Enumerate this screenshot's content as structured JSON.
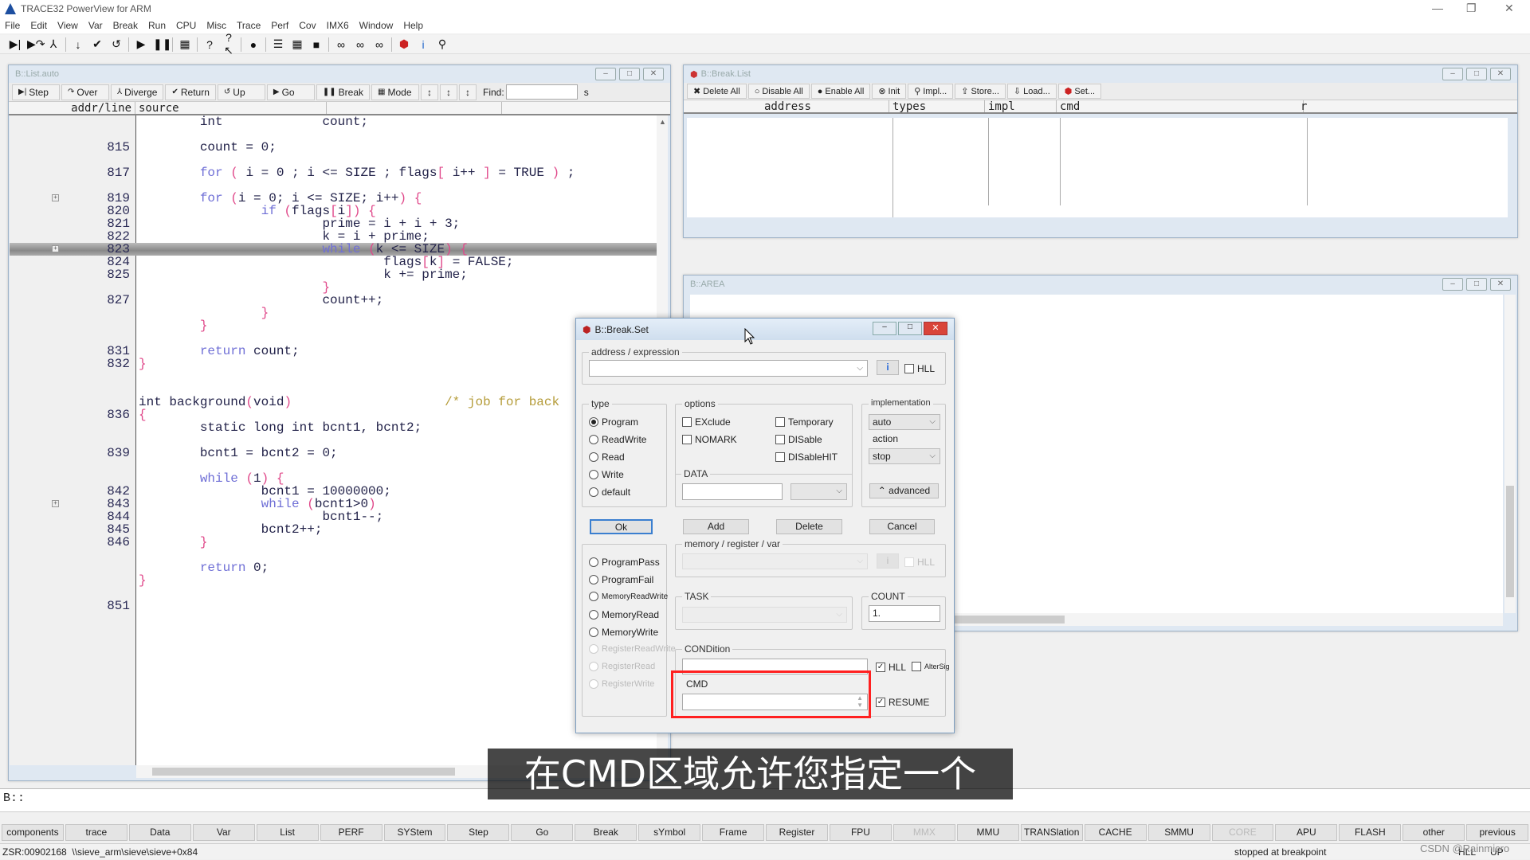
{
  "app": {
    "title": "TRACE32 PowerView for ARM"
  },
  "menu": [
    "File",
    "Edit",
    "View",
    "Var",
    "Break",
    "Run",
    "CPU",
    "Misc",
    "Trace",
    "Perf",
    "Cov",
    "IMX6",
    "Window",
    "Help"
  ],
  "toolbar_icons": [
    "step-icon",
    "over-icon",
    "diverge-icon",
    "down-icon",
    "return-icon",
    "up-icon",
    "go-icon",
    "break-icon",
    "mode-icon",
    "help-icon",
    "context-help-icon",
    "stop-icon",
    "list-icon",
    "mix-icon",
    "memory-icon",
    "view1-icon",
    "view2-icon",
    "view3-icon",
    "breakpoint-icon",
    "info-icon",
    "wrench-icon"
  ],
  "list_window": {
    "title": "B::List.auto",
    "buttons": [
      "Step",
      "Over",
      "Diverge",
      "Return",
      "Up",
      "Go",
      "Break",
      "Mode"
    ],
    "button_icons": [
      "▶|",
      "↷",
      "⅄",
      "✔",
      "↺",
      "▶",
      "❚❚",
      "▦"
    ],
    "find_label": "Find:",
    "find_value": "",
    "trailing": "s",
    "headers": [
      "addr/line",
      "source"
    ],
    "rows": [
      {
        "n": "",
        "t": [
          [
            "n",
            "        int             count;"
          ]
        ]
      },
      {
        "n": "",
        "t": []
      },
      {
        "n": "815",
        "t": [
          [
            "n",
            "        count = 0;"
          ]
        ]
      },
      {
        "n": "",
        "t": []
      },
      {
        "n": "817",
        "t": [
          [
            "n",
            "        "
          ],
          [
            "k",
            "for"
          ],
          [
            "n",
            " "
          ],
          [
            "p",
            "("
          ],
          [
            "n",
            " i = 0 ; i <= SIZE ; flags"
          ],
          [
            "p",
            "["
          ],
          [
            "n",
            " i++ "
          ],
          [
            "p",
            "]"
          ],
          [
            "n",
            " = TRUE "
          ],
          [
            "p",
            ")"
          ],
          [
            "n",
            " ;"
          ]
        ]
      },
      {
        "n": "",
        "t": []
      },
      {
        "n": "819",
        "m": true,
        "t": [
          [
            "n",
            "        "
          ],
          [
            "k",
            "for"
          ],
          [
            "n",
            " "
          ],
          [
            "p",
            "("
          ],
          [
            "n",
            "i = 0; i <= SIZE; i++"
          ],
          [
            "p",
            ")"
          ],
          [
            "n",
            " "
          ],
          [
            "p",
            "{"
          ]
        ]
      },
      {
        "n": "820",
        "t": [
          [
            "n",
            "                "
          ],
          [
            "k",
            "if"
          ],
          [
            "n",
            " "
          ],
          [
            "p",
            "("
          ],
          [
            "n",
            "flags"
          ],
          [
            "p",
            "["
          ],
          [
            "n",
            "i"
          ],
          [
            "p",
            "])"
          ],
          [
            "n",
            " "
          ],
          [
            "p",
            "{"
          ]
        ]
      },
      {
        "n": "821",
        "t": [
          [
            "n",
            "                        prime = i + i + 3;"
          ]
        ]
      },
      {
        "n": "822",
        "t": [
          [
            "n",
            "                        k = i + prime;"
          ]
        ]
      },
      {
        "n": "823",
        "m": true,
        "hl": true,
        "t": [
          [
            "n",
            "                        "
          ],
          [
            "k",
            "while"
          ],
          [
            "n",
            " "
          ],
          [
            "p",
            "("
          ],
          [
            "n",
            "k <= SIZE"
          ],
          [
            "p",
            ")"
          ],
          [
            "n",
            " "
          ],
          [
            "p",
            "{"
          ]
        ]
      },
      {
        "n": "824",
        "t": [
          [
            "n",
            "                                flags"
          ],
          [
            "p",
            "["
          ],
          [
            "n",
            "k"
          ],
          [
            "p",
            "]"
          ],
          [
            "n",
            " = FALSE;"
          ]
        ]
      },
      {
        "n": "825",
        "t": [
          [
            "n",
            "                                k += prime;"
          ]
        ]
      },
      {
        "n": "",
        "t": [
          [
            "n",
            "                        "
          ],
          [
            "p",
            "}"
          ]
        ]
      },
      {
        "n": "827",
        "t": [
          [
            "n",
            "                        count++;"
          ]
        ]
      },
      {
        "n": "",
        "t": [
          [
            "n",
            "                "
          ],
          [
            "p",
            "}"
          ]
        ]
      },
      {
        "n": "",
        "t": [
          [
            "n",
            "        "
          ],
          [
            "p",
            "}"
          ]
        ]
      },
      {
        "n": "",
        "t": []
      },
      {
        "n": "831",
        "t": [
          [
            "n",
            "        "
          ],
          [
            "k",
            "return"
          ],
          [
            "n",
            " count;"
          ]
        ]
      },
      {
        "n": "832",
        "t": [
          [
            "p",
            "}"
          ]
        ]
      },
      {
        "n": "",
        "t": []
      },
      {
        "n": "",
        "t": []
      },
      {
        "n": "",
        "t": [
          [
            "n",
            "int background"
          ],
          [
            "p",
            "("
          ],
          [
            "n",
            "void"
          ],
          [
            "p",
            ")"
          ],
          [
            "n",
            "                    "
          ],
          [
            "c",
            "/* job for back"
          ]
        ]
      },
      {
        "n": "836",
        "t": [
          [
            "p",
            "{"
          ]
        ]
      },
      {
        "n": "",
        "t": [
          [
            "n",
            "        static long int bcnt1, bcnt2;"
          ]
        ]
      },
      {
        "n": "",
        "t": []
      },
      {
        "n": "839",
        "t": [
          [
            "n",
            "        bcnt1 = bcnt2 = 0;"
          ]
        ]
      },
      {
        "n": "",
        "t": []
      },
      {
        "n": "",
        "t": [
          [
            "n",
            "        "
          ],
          [
            "k",
            "while"
          ],
          [
            "n",
            " "
          ],
          [
            "p",
            "("
          ],
          [
            "n",
            "1"
          ],
          [
            "p",
            ")"
          ],
          [
            "n",
            " "
          ],
          [
            "p",
            "{"
          ]
        ]
      },
      {
        "n": "842",
        "t": [
          [
            "n",
            "                bcnt1 = 10000000;"
          ]
        ]
      },
      {
        "n": "843",
        "m": true,
        "t": [
          [
            "n",
            "                "
          ],
          [
            "k",
            "while"
          ],
          [
            "n",
            " "
          ],
          [
            "p",
            "("
          ],
          [
            "n",
            "bcnt1>0"
          ],
          [
            "p",
            ")"
          ]
        ]
      },
      {
        "n": "844",
        "t": [
          [
            "n",
            "                        bcnt1--;"
          ]
        ]
      },
      {
        "n": "845",
        "t": [
          [
            "n",
            "                bcnt2++;"
          ]
        ]
      },
      {
        "n": "846",
        "t": [
          [
            "n",
            "        "
          ],
          [
            "p",
            "}"
          ]
        ]
      },
      {
        "n": "",
        "t": []
      },
      {
        "n": "",
        "t": [
          [
            "n",
            "        "
          ],
          [
            "k",
            "return"
          ],
          [
            "n",
            " 0;"
          ]
        ]
      },
      {
        "n": "",
        "t": [
          [
            "p",
            "}"
          ]
        ]
      },
      {
        "n": "",
        "t": []
      },
      {
        "n": "851",
        "t": []
      }
    ]
  },
  "breaklist_window": {
    "title": "B::Break.List",
    "buttons": [
      "Delete All",
      "Disable All",
      "Enable All",
      "Init",
      "Impl...",
      "Store...",
      "Load...",
      "Set..."
    ],
    "button_icons": [
      "✖",
      "○",
      "●",
      "⊗",
      "⚲",
      "⇪",
      "⇩",
      "⬢"
    ],
    "headers": [
      "address",
      "types",
      "impl",
      "cmd",
      "r"
    ]
  },
  "area_window": {
    "title": "B::AREA"
  },
  "dialog": {
    "title": "B::Break.Set",
    "address_label": "address / expression",
    "address_value": "",
    "hll_label": "HLL",
    "type_label": "type",
    "types": [
      "Program",
      "ReadWrite",
      "Read",
      "Write",
      "default"
    ],
    "type_selected": "Program",
    "options_label": "options",
    "options": [
      {
        "label": "EXclude",
        "checked": false
      },
      {
        "label": "Temporary",
        "checked": false
      },
      {
        "label": "NOMARK",
        "checked": false
      },
      {
        "label": "DISable",
        "checked": false
      },
      {
        "label": "DISableHIT",
        "checked": false
      }
    ],
    "implementation_label": "implementation",
    "implementation_value": "auto",
    "action_label": "action",
    "action_value": "stop",
    "advanced_label": "advanced",
    "data_label": "DATA",
    "data_value": "",
    "ok": "Ok",
    "add": "Add",
    "delete": "Delete",
    "cancel": "Cancel",
    "types2": [
      "ProgramPass",
      "ProgramFail",
      "MemoryReadWrite",
      "MemoryRead",
      "MemoryWrite"
    ],
    "types2_disabled": [
      "RegisterReadWrite",
      "RegisterRead",
      "RegisterWrite"
    ],
    "memory_label": "memory / register / var",
    "memory_hll": "HLL",
    "task_label": "TASK",
    "count_label": "COUNT",
    "count_value": "1.",
    "condition_label": "CONDition",
    "condition_value": "",
    "cond_hll": "HLL",
    "cond_hll_checked": true,
    "cond_altersig": "AlterSig",
    "cond_altersig_checked": false,
    "cmd_label": "CMD",
    "cmd_value": "",
    "resume_label": "RESUME",
    "resume_checked": true,
    "highlight_color": "#ff2020"
  },
  "command_line": {
    "prompt": "B::",
    "value": ""
  },
  "bottom_buttons": [
    {
      "l": "components"
    },
    {
      "l": "trace"
    },
    {
      "l": "Data"
    },
    {
      "l": "Var"
    },
    {
      "l": "List"
    },
    {
      "l": "PERF"
    },
    {
      "l": "SYStem"
    },
    {
      "l": "Step"
    },
    {
      "l": "Go"
    },
    {
      "l": "Break"
    },
    {
      "l": "sYmbol"
    },
    {
      "l": "Frame"
    },
    {
      "l": "Register"
    },
    {
      "l": "FPU"
    },
    {
      "l": "MMX",
      "off": true
    },
    {
      "l": "MMU"
    },
    {
      "l": "TRANSlation"
    },
    {
      "l": "CACHE"
    },
    {
      "l": "SMMU"
    },
    {
      "l": "CORE",
      "off": true
    },
    {
      "l": "APU"
    },
    {
      "l": "FLASH"
    },
    {
      "l": "other"
    },
    {
      "l": "previous"
    }
  ],
  "status": {
    "location": "ZSR:00902168  \\\\sieve_arm\\sieve\\sieve+0x84",
    "state": "stopped at breakpoint",
    "mode1": "HLL",
    "mode2": "UP"
  },
  "subtitle": "在CMD区域允许您指定一个",
  "watermark": "CSDN @Rainmicro"
}
